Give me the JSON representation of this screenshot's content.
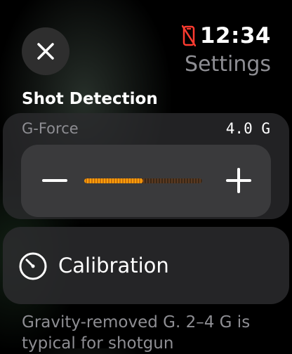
{
  "status": {
    "time": "12:34",
    "indicator_icon": "phone-disconnected-icon",
    "indicator_color": "#ff3b30"
  },
  "nav": {
    "title": "Settings",
    "close_icon": "close-icon"
  },
  "section": {
    "title": "Shot Detection"
  },
  "gforce": {
    "label": "G-Force",
    "value": "4.0 G",
    "slider_fraction": 0.5,
    "accent_color": "#ff9f0a"
  },
  "calibration": {
    "label": "Calibration",
    "icon": "gauge-icon"
  },
  "footnote": {
    "text": "Gravity-removed G. 2–4 G is typical for shotgun"
  }
}
